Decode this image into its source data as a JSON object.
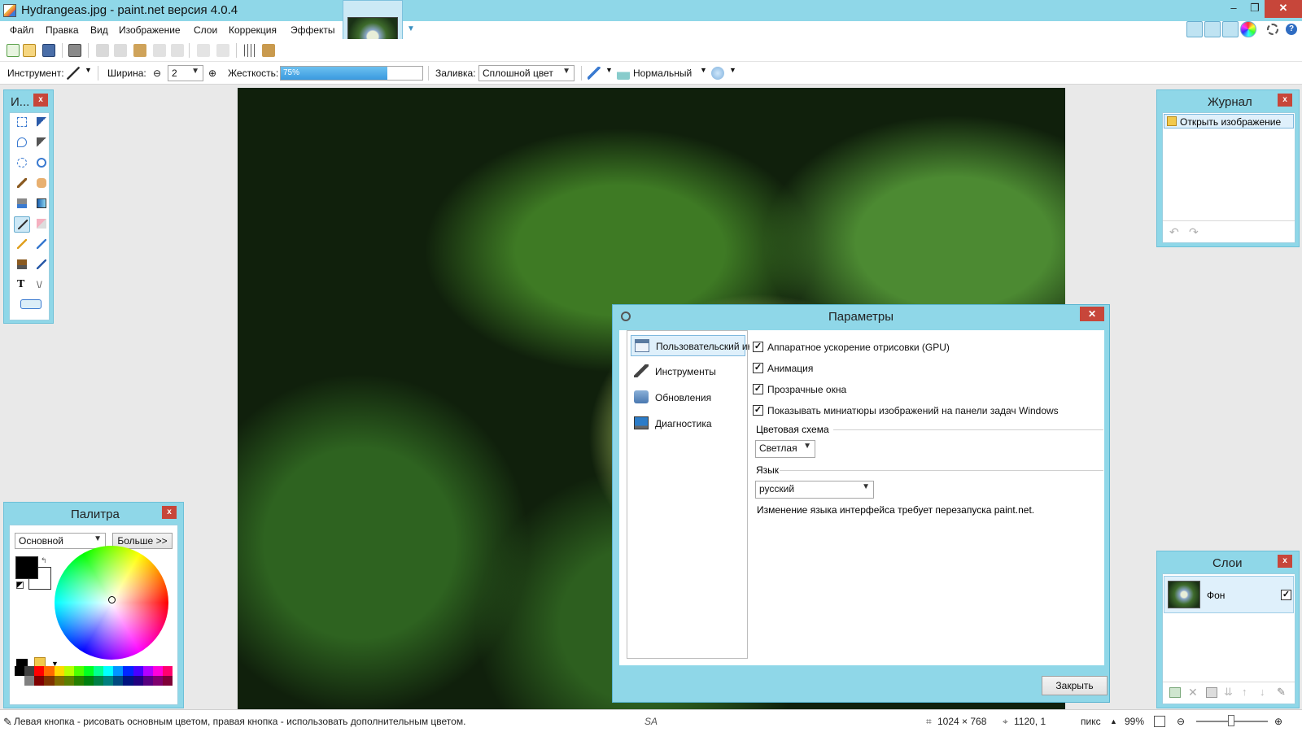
{
  "window": {
    "title": "Hydrangeas.jpg - paint.net версия 4.0.4",
    "minimize": "–",
    "maximize": "❐",
    "close": "✕"
  },
  "menu": [
    "Файл",
    "Правка",
    "Вид",
    "Изображение",
    "Слои",
    "Коррекция",
    "Эффекты"
  ],
  "toolbar": {
    "tool_label": "Инструмент:",
    "width_label": "Ширина:",
    "width_value": "2",
    "hardness_label": "Жесткость:",
    "hardness_value": "75%",
    "hardness_fraction": 0.75,
    "fill_label": "Заливка:",
    "fill_value": "Сплошной цвет",
    "blend_value": "Нормальный"
  },
  "tools_panel": {
    "title": "И...",
    "close": "x"
  },
  "palette_panel": {
    "title": "Палитра",
    "close": "x",
    "mode_value": "Основной",
    "more_button": "Больше >>",
    "primary_color": "#000000",
    "secondary_color": "#ffffff",
    "swatches": [
      "#000000",
      "#404040",
      "#ff0000",
      "#ff6a00",
      "#ffd800",
      "#b6ff00",
      "#4cff00",
      "#00ff21",
      "#00ff90",
      "#00ffff",
      "#0094ff",
      "#0026ff",
      "#4800ff",
      "#b200ff",
      "#ff00dc",
      "#ff006e",
      "#ffffff",
      "#808080",
      "#7f0000",
      "#7f3300",
      "#7f6a00",
      "#5b7f00",
      "#267f00",
      "#007f0e",
      "#007f46",
      "#007f7f",
      "#004a7f",
      "#00137f",
      "#21007f",
      "#57007f",
      "#7f006e",
      "#7f0037"
    ]
  },
  "history_panel": {
    "title": "Журнал",
    "close": "x",
    "items": [
      "Открыть изображение"
    ]
  },
  "layers_panel": {
    "title": "Слои",
    "close": "x",
    "layers": [
      {
        "name": "Фон",
        "visible": true
      }
    ]
  },
  "dialog": {
    "title": "Параметры",
    "close": "✕",
    "nav": [
      "Пользовательский ин",
      "Инструменты",
      "Обновления",
      "Диагностика"
    ],
    "selected_nav": 0,
    "options": [
      {
        "label": "Аппаратное ускорение отрисовки (GPU)",
        "checked": true
      },
      {
        "label": "Анимация",
        "checked": true
      },
      {
        "label": "Прозрачные окна",
        "checked": true
      },
      {
        "label": "Показывать миниатюры изображений на панели задач Windows",
        "checked": true
      }
    ],
    "color_scheme_label": "Цветовая схема",
    "color_scheme_value": "Светлая",
    "language_label": "Язык",
    "language_value": "русский",
    "language_note": "Изменение языка интерфейса требует перезапуска paint.net.",
    "close_button": "Закрыть"
  },
  "status": {
    "hint": "Левая кнопка - рисовать основным цветом, правая кнопка - использовать дополнительным цветом.",
    "image_size": "1024 × 768",
    "cursor_pos": "1120, 1",
    "units": "пикс",
    "zoom": "99%"
  }
}
